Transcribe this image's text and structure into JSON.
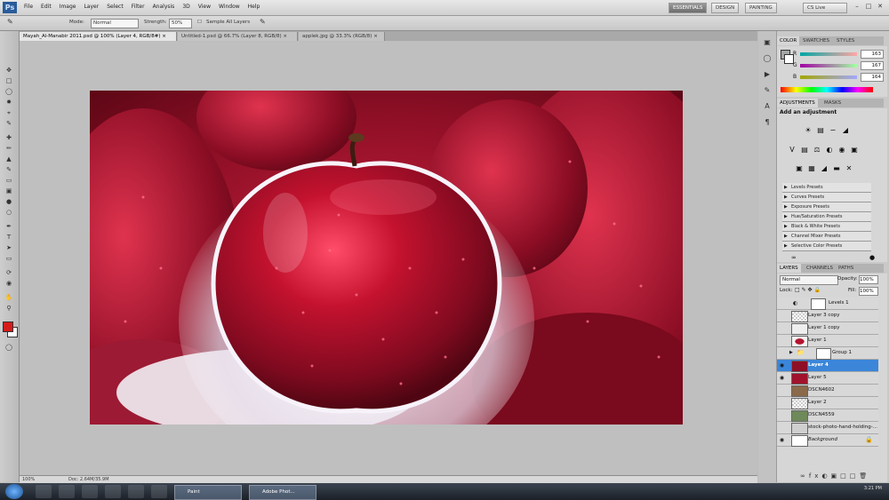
{
  "app": {
    "logo": "Ps"
  },
  "menu": [
    "File",
    "Edit",
    "Image",
    "Layer",
    "Select",
    "Filter",
    "Analysis",
    "3D",
    "View",
    "Window",
    "Help"
  ],
  "menubar_right": {
    "essentials": "ESSENTIALS",
    "design": "DESIGN",
    "painting": "PAINTING",
    "search": "CS Live"
  },
  "options": {
    "mode_label": "Mode:",
    "mode_value": "Normal",
    "strength_label": "Strength:",
    "strength_value": "50%",
    "sample_all": "Sample All Layers"
  },
  "tabs": [
    {
      "label": "Mayah_Al-Manabir 2011.psd @ 100% (Layer 4, RGB/8#)"
    },
    {
      "label": "Untitled-1.psd @ 66.7% (Layer 8, RGB/8)"
    },
    {
      "label": "applek.jpg @ 33.3% (RGB/8)"
    }
  ],
  "status": {
    "zoom": "100%",
    "doc": "Doc: 2.64M/35.9M"
  },
  "color_panel": {
    "tabs": [
      "COLOR",
      "SWATCHES",
      "STYLES"
    ],
    "r_label": "R",
    "g_label": "G",
    "b_label": "B",
    "r": "163",
    "g": "167",
    "b": "164"
  },
  "adjustments": {
    "tabs": [
      "ADJUSTMENTS",
      "MASKS"
    ],
    "title": "Add an adjustment",
    "presets": [
      "Levels Presets",
      "Curves Presets",
      "Exposure Presets",
      "Hue/Saturation Presets",
      "Black & White Presets",
      "Channel Mixer Presets",
      "Selective Color Presets"
    ]
  },
  "layers_panel": {
    "tabs": [
      "LAYERS",
      "CHANNELS",
      "PATHS"
    ],
    "blend": "Normal",
    "opacity_label": "Opacity:",
    "opacity": "100%",
    "lock_label": "Lock:",
    "fill_label": "Fill:",
    "fill": "100%",
    "layers": [
      {
        "name": "Levels 1"
      },
      {
        "name": "Layer 3 copy"
      },
      {
        "name": "Layer 1 copy"
      },
      {
        "name": "Layer 1"
      },
      {
        "name": "Group 1"
      },
      {
        "name": "Layer 4"
      },
      {
        "name": "Layer 5"
      },
      {
        "name": "DSCN4602"
      },
      {
        "name": "Layer 2"
      },
      {
        "name": "DSCN4559"
      },
      {
        "name": "stock-photo-hand-holding-..."
      },
      {
        "name": "Background"
      }
    ]
  },
  "taskbar": {
    "task1": "Paint",
    "task2": "Adobe Phot...",
    "clock": "3:21 PM"
  },
  "colors": {
    "accent": "#3b86d9",
    "foreground": "#d51b1b",
    "background": "#ffffff"
  }
}
